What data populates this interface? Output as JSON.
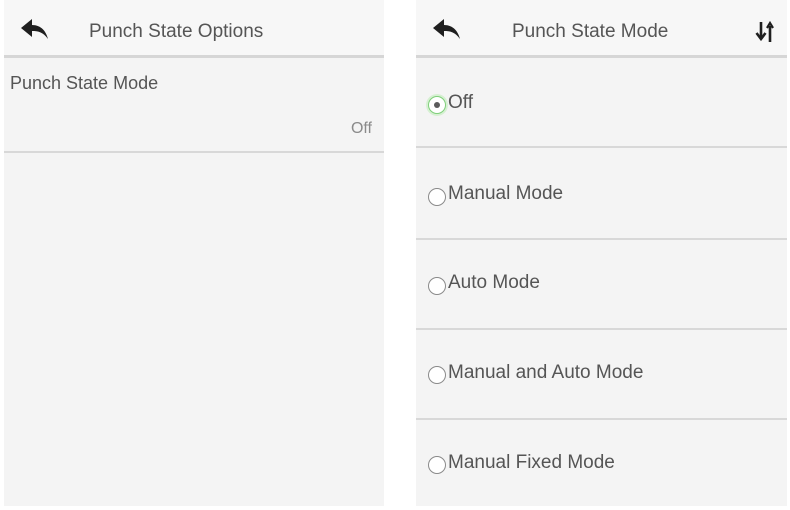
{
  "left_screen": {
    "header": {
      "back_icon": "back-arrow-icon",
      "title": "Punch State Options"
    },
    "items": [
      {
        "label": "Punch State Mode",
        "value": "Off"
      }
    ]
  },
  "right_screen": {
    "header": {
      "back_icon": "back-arrow-icon",
      "title": "Punch State Mode",
      "sort_icon": "sort-arrows-icon"
    },
    "selected_index": 0,
    "options": [
      {
        "label": "Off",
        "selected": true
      },
      {
        "label": "Manual Mode",
        "selected": false
      },
      {
        "label": "Auto Mode",
        "selected": false
      },
      {
        "label": "Manual and Auto Mode",
        "selected": false
      },
      {
        "label": "Manual Fixed Mode",
        "selected": false
      }
    ]
  },
  "colors": {
    "background": "#ffffff",
    "panel": "#f4f4f4",
    "divider": "#d8d8d8",
    "text": "#555555",
    "value_text": "#8a8a8a",
    "radio_selected_accent": "#7fcf7a"
  }
}
